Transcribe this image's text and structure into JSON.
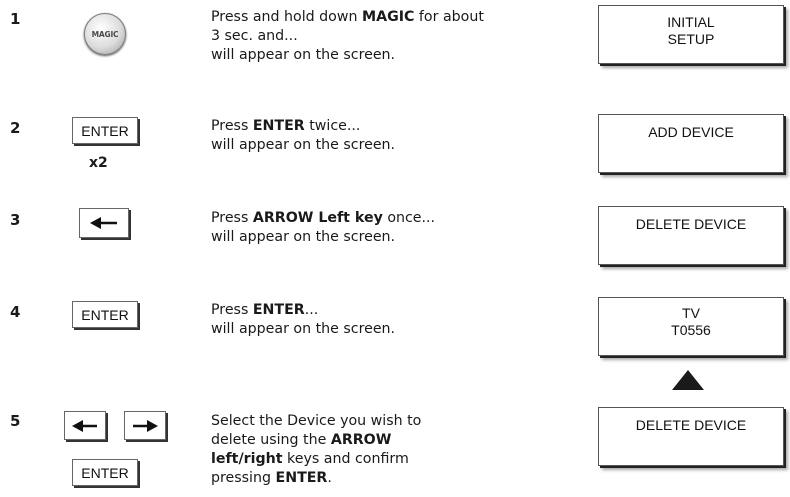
{
  "steps": [
    {
      "number": "1",
      "key_label": "MAGIC",
      "instruction": {
        "pre": "Press and hold down ",
        "bold": "MAGIC",
        "line1_post": " for about",
        "line2": "3 sec. and...",
        "line3": "will appear on the screen."
      },
      "screen": [
        "INITIAL",
        "SETUP"
      ]
    },
    {
      "number": "2",
      "key_label": "ENTER",
      "multiplier": "x2",
      "instruction": {
        "pre": "Press ",
        "bold": "ENTER",
        "post": " twice...",
        "line2": "will appear on the screen."
      },
      "screen": [
        "ADD DEVICE"
      ]
    },
    {
      "number": "3",
      "key_icon": "arrow-left-icon",
      "instruction": {
        "pre": "Press ",
        "bold": "ARROW Left key",
        "post": " once...",
        "line2": "will appear on the screen."
      },
      "screen": [
        "DELETE DEVICE"
      ]
    },
    {
      "number": "4",
      "key_label": "ENTER",
      "instruction": {
        "pre": "Press ",
        "bold": "ENTER",
        "post": "...",
        "line2": "will appear on the screen."
      },
      "screen": [
        "TV",
        "T0556"
      ],
      "pointer_icon": "triangle-up-icon"
    },
    {
      "number": "5",
      "key_icons": [
        "arrow-left-icon",
        "arrow-right-icon"
      ],
      "key_label": "ENTER",
      "instruction": {
        "line1": "Select the Device you wish to",
        "line2_pre": "delete using the ",
        "line2_bold": "ARROW",
        "line3_bold": "left/right",
        "line3_post": " keys and confirm",
        "line4_pre": "pressing ",
        "line4_bold": "ENTER",
        "line4_post": "."
      },
      "screen": [
        "DELETE DEVICE"
      ]
    }
  ]
}
